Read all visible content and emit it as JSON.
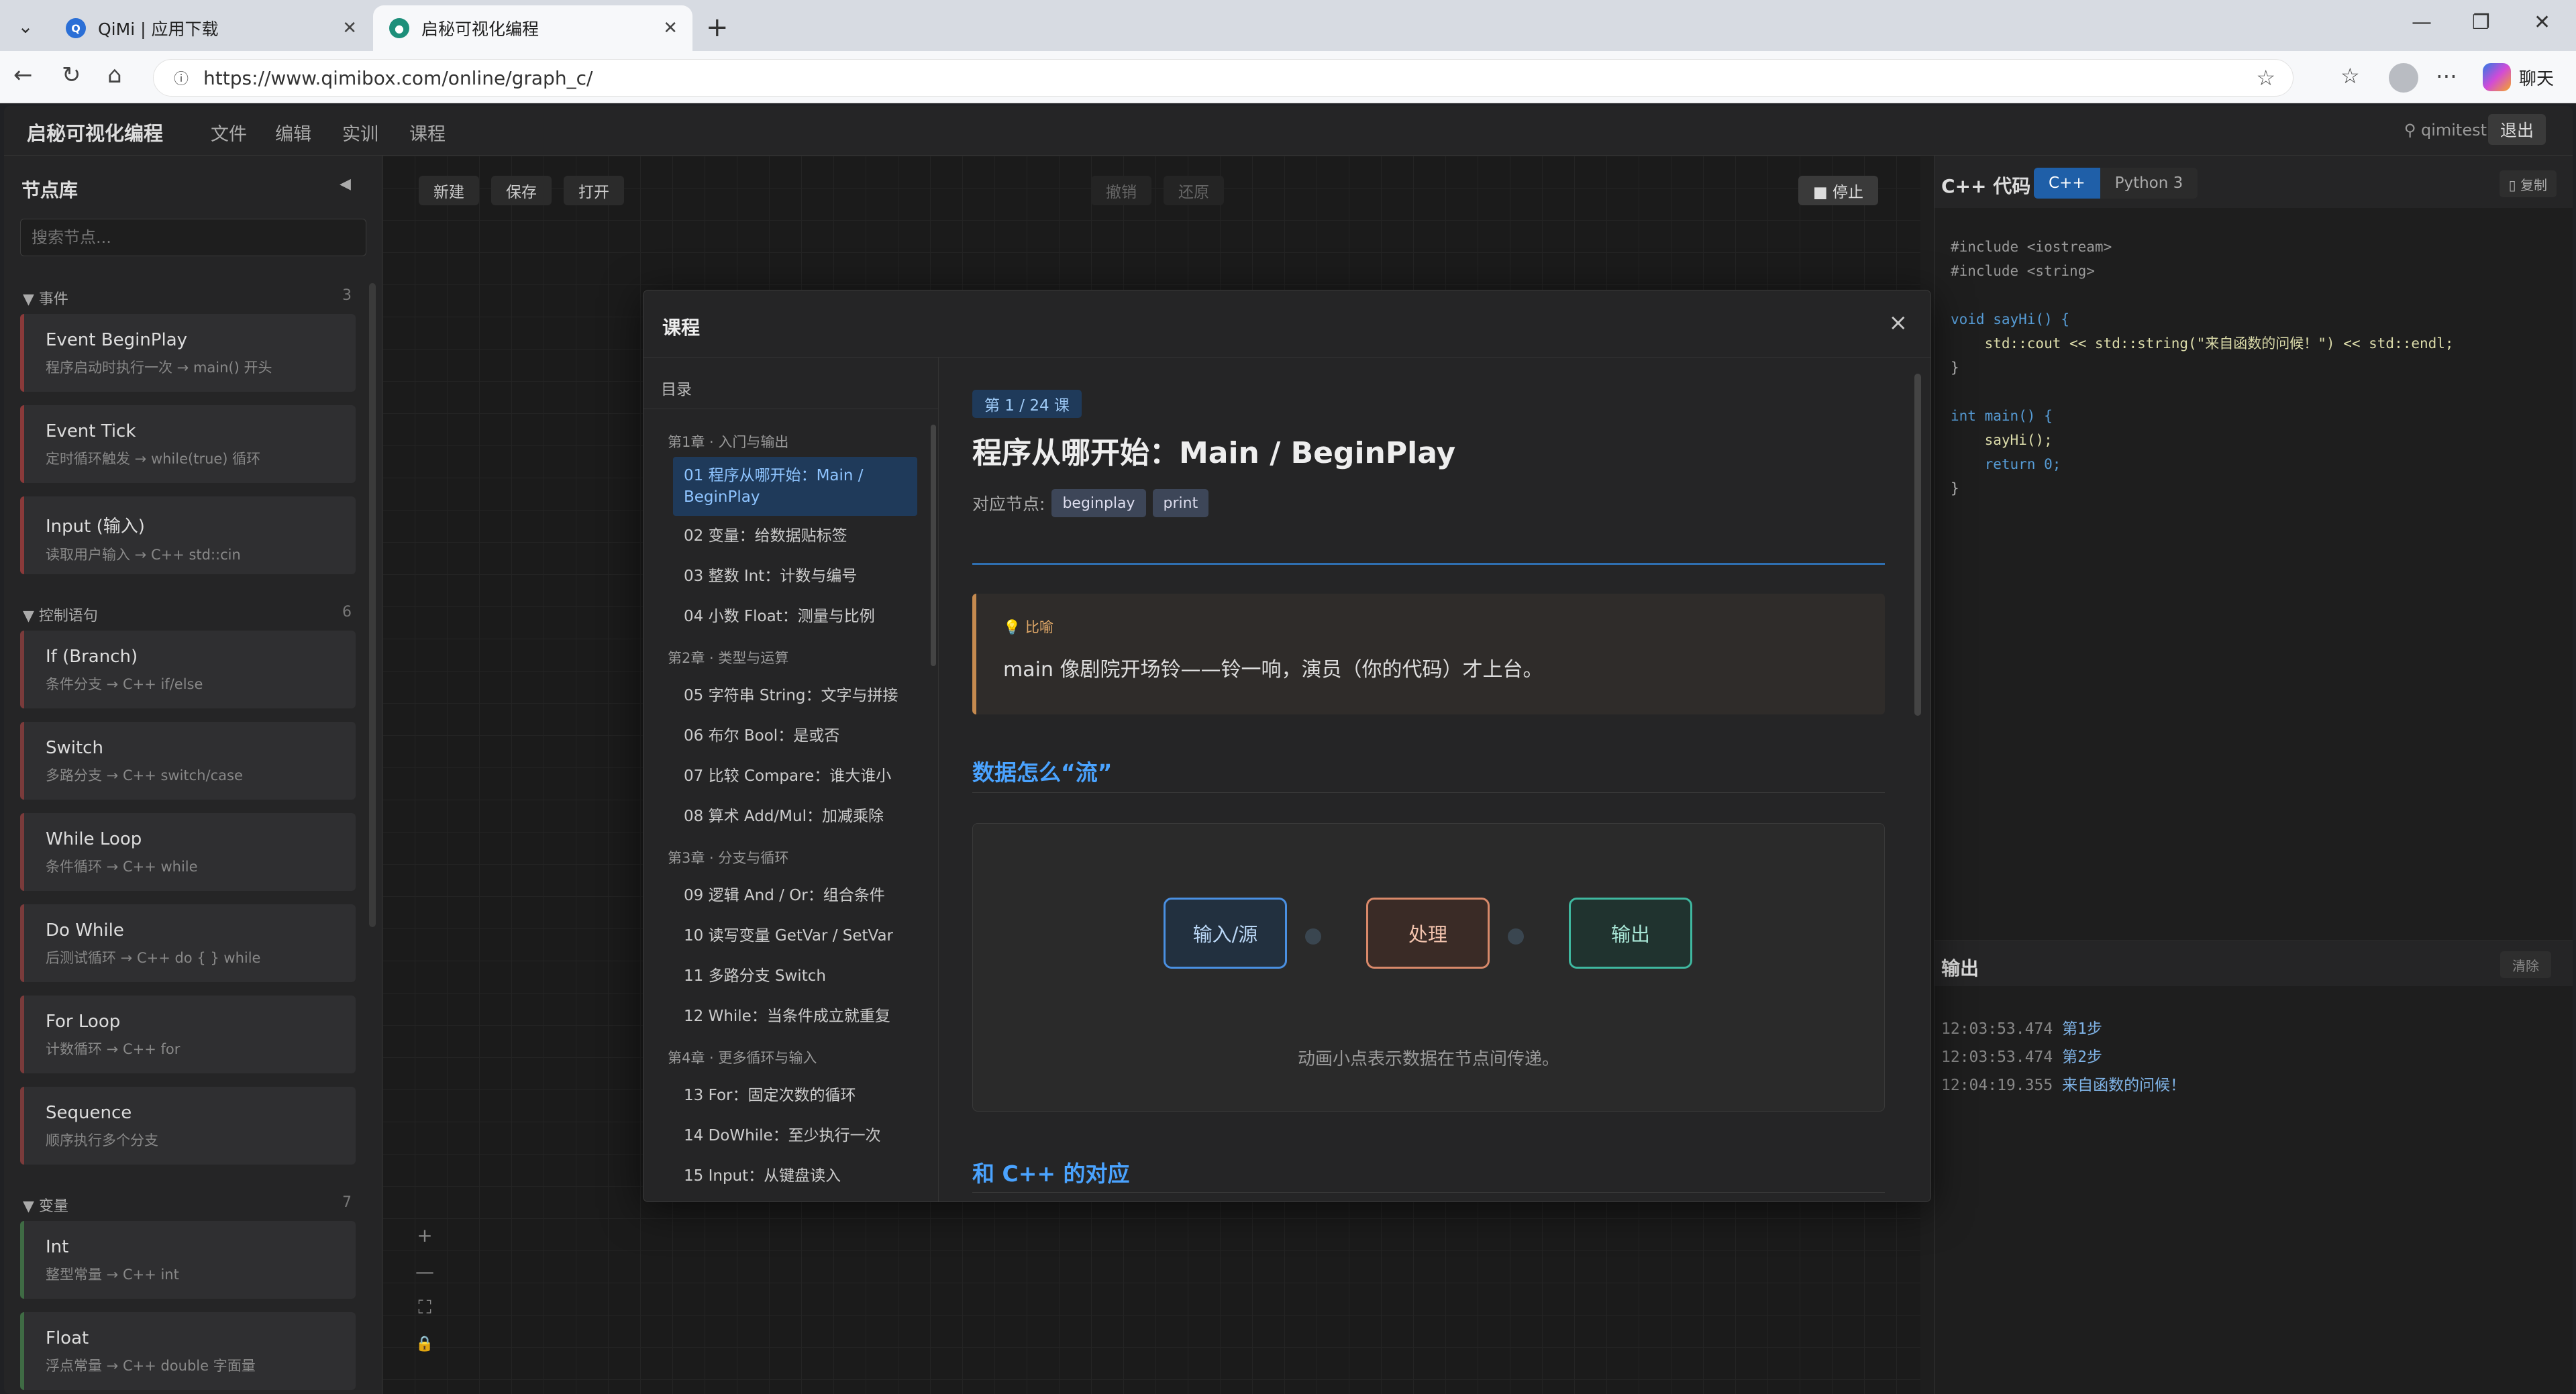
{
  "browser": {
    "tabs": [
      {
        "title": "QiMi | 应用下载",
        "active": false
      },
      {
        "title": "启秘可视化编程",
        "active": true
      }
    ],
    "url": "https://www.qimibox.com/online/graph_c/",
    "copilot_label": "聊天"
  },
  "app": {
    "title": "启秘可视化编程",
    "menu": [
      "文件",
      "编辑",
      "实训",
      "课程"
    ],
    "user": "qimitest",
    "logout": "退出"
  },
  "sidebar": {
    "title": "节点库",
    "search_placeholder": "搜索节点...",
    "groups": [
      {
        "name": "事件",
        "count": "3",
        "items": [
          {
            "title": "Event BeginPlay",
            "desc": "程序启动时执行一次 → main() 开头"
          },
          {
            "title": "Event Tick",
            "desc": "定时循环触发 → while(true) 循环"
          },
          {
            "title": "Input (输入)",
            "desc": "读取用户输入 → C++ std::cin"
          }
        ]
      },
      {
        "name": "控制语句",
        "count": "6",
        "items": [
          {
            "title": "If (Branch)",
            "desc": "条件分支 → C++ if/else"
          },
          {
            "title": "Switch",
            "desc": "多路分支 → C++ switch/case"
          },
          {
            "title": "While Loop",
            "desc": "条件循环 → C++ while"
          },
          {
            "title": "Do While",
            "desc": "后测试循环 → C++ do { } while"
          },
          {
            "title": "For Loop",
            "desc": "计数循环 → C++ for"
          },
          {
            "title": "Sequence",
            "desc": "顺序执行多个分支"
          }
        ]
      },
      {
        "name": "变量",
        "count": "7",
        "items": [
          {
            "title": "Int",
            "desc": "整型常量 → C++ int"
          },
          {
            "title": "Float",
            "desc": "浮点常量 → C++ double 字面量"
          }
        ]
      }
    ]
  },
  "canvas": {
    "buttons": [
      "新建",
      "保存",
      "打开"
    ],
    "undo": "撤销",
    "redo": "还原",
    "stop": "■ 停止",
    "zoom_controls": [
      "+",
      "—",
      "⛶",
      "🔒"
    ]
  },
  "code_panel": {
    "title": "C++ 代码",
    "tabs": [
      "C++",
      "Python 3"
    ],
    "active_tab": "C++",
    "copy": "▯ 复制",
    "lines": [
      "#include <iostream>",
      "#include <string>",
      "",
      "void sayHi() {",
      "    std::cout << std::string(\"来自函数的问候！\") << std::endl;",
      "}",
      "",
      "int main() {",
      "    sayHi();",
      "    return 0;",
      "}"
    ]
  },
  "output_panel": {
    "title": "输出",
    "clear": "清除",
    "logs": [
      {
        "time": "12:03:53.474",
        "msg": "第1步"
      },
      {
        "time": "12:03:53.474",
        "msg": "第2步"
      },
      {
        "time": "12:04:19.355",
        "msg": "来自函数的问候！"
      }
    ]
  },
  "course_modal": {
    "title": "课程",
    "close": "×",
    "toc_title": "目录",
    "chapters": [
      {
        "name": "第1章 · 入门与输出",
        "lessons": [
          "01 程序从哪开始：Main / BeginPlay",
          "02 变量：给数据贴标签",
          "03 整数 Int：计数与编号",
          "04 小数 Float：测量与比例"
        ]
      },
      {
        "name": "第2章 · 类型与运算",
        "lessons": [
          "05 字符串 String：文字与拼接",
          "06 布尔 Bool：是或否",
          "07 比较 Compare：谁大谁小",
          "08 算术 Add/Mul：加减乘除"
        ]
      },
      {
        "name": "第3章 · 分支与循环",
        "lessons": [
          "09 逻辑 And / Or：组合条件",
          "10 读写变量 GetVar / SetVar",
          "11 多路分支 Switch",
          "12 While：当条件成立就重复"
        ]
      },
      {
        "name": "第4章 · 更多循环与输入",
        "lessons": [
          "13 For：固定次数的循环",
          "14 DoWhile：至少执行一次",
          "15 Input：从键盘读入"
        ]
      }
    ],
    "lesson": {
      "badge": "第 1 / 24 课",
      "title": "程序从哪开始：Main / BeginPlay",
      "nodes_label": "对应节点:",
      "nodes": [
        "beginplay",
        "print"
      ],
      "metaphor_label": "💡 比喻",
      "metaphor_text": "main 像剧院开场铃——铃一响，演员（你的代码）才上台。",
      "section1": "数据怎么“流”",
      "flow_boxes": [
        "输入/源",
        "处理",
        "输出"
      ],
      "flow_caption": "动画小点表示数据在节点间传递。",
      "section2": "和 C++ 的对应"
    }
  }
}
